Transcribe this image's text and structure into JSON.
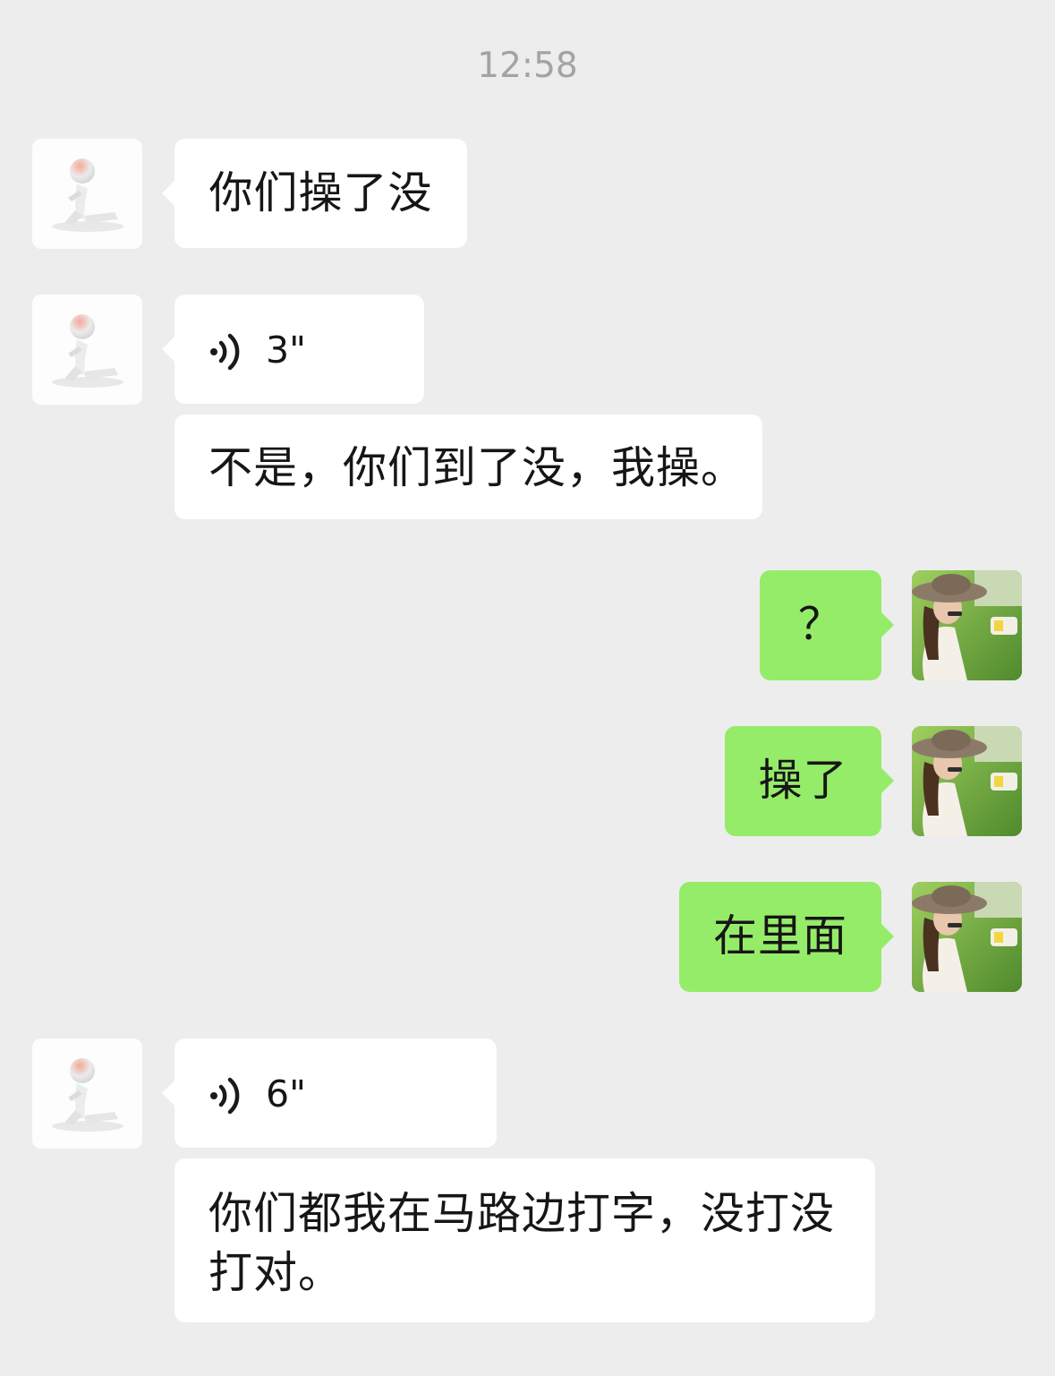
{
  "chat": {
    "timestamp": "12:58",
    "messages": [
      {
        "side": "them",
        "kind": "text",
        "text": "你们操了没"
      },
      {
        "side": "them",
        "kind": "voice",
        "duration": "3\""
      },
      {
        "side": "them",
        "kind": "text",
        "text": "不是，你们到了没，我操。"
      },
      {
        "side": "me",
        "kind": "text",
        "text": "？"
      },
      {
        "side": "me",
        "kind": "text",
        "text": "操了"
      },
      {
        "side": "me",
        "kind": "text",
        "text": "在里面"
      },
      {
        "side": "them",
        "kind": "voice",
        "duration": "6\""
      },
      {
        "side": "them",
        "kind": "text",
        "text": "你们都我在马路边打字，没打没打对。"
      }
    ]
  },
  "colors": {
    "background": "#ededed",
    "bubble_me": "#95ec69",
    "bubble_them": "#ffffff",
    "timestamp": "#a3a3a3",
    "text": "#161616"
  },
  "icons": {
    "voice": "voice-wave-icon",
    "avatar_them": "figure-avatar",
    "avatar_me": "photo-avatar"
  }
}
